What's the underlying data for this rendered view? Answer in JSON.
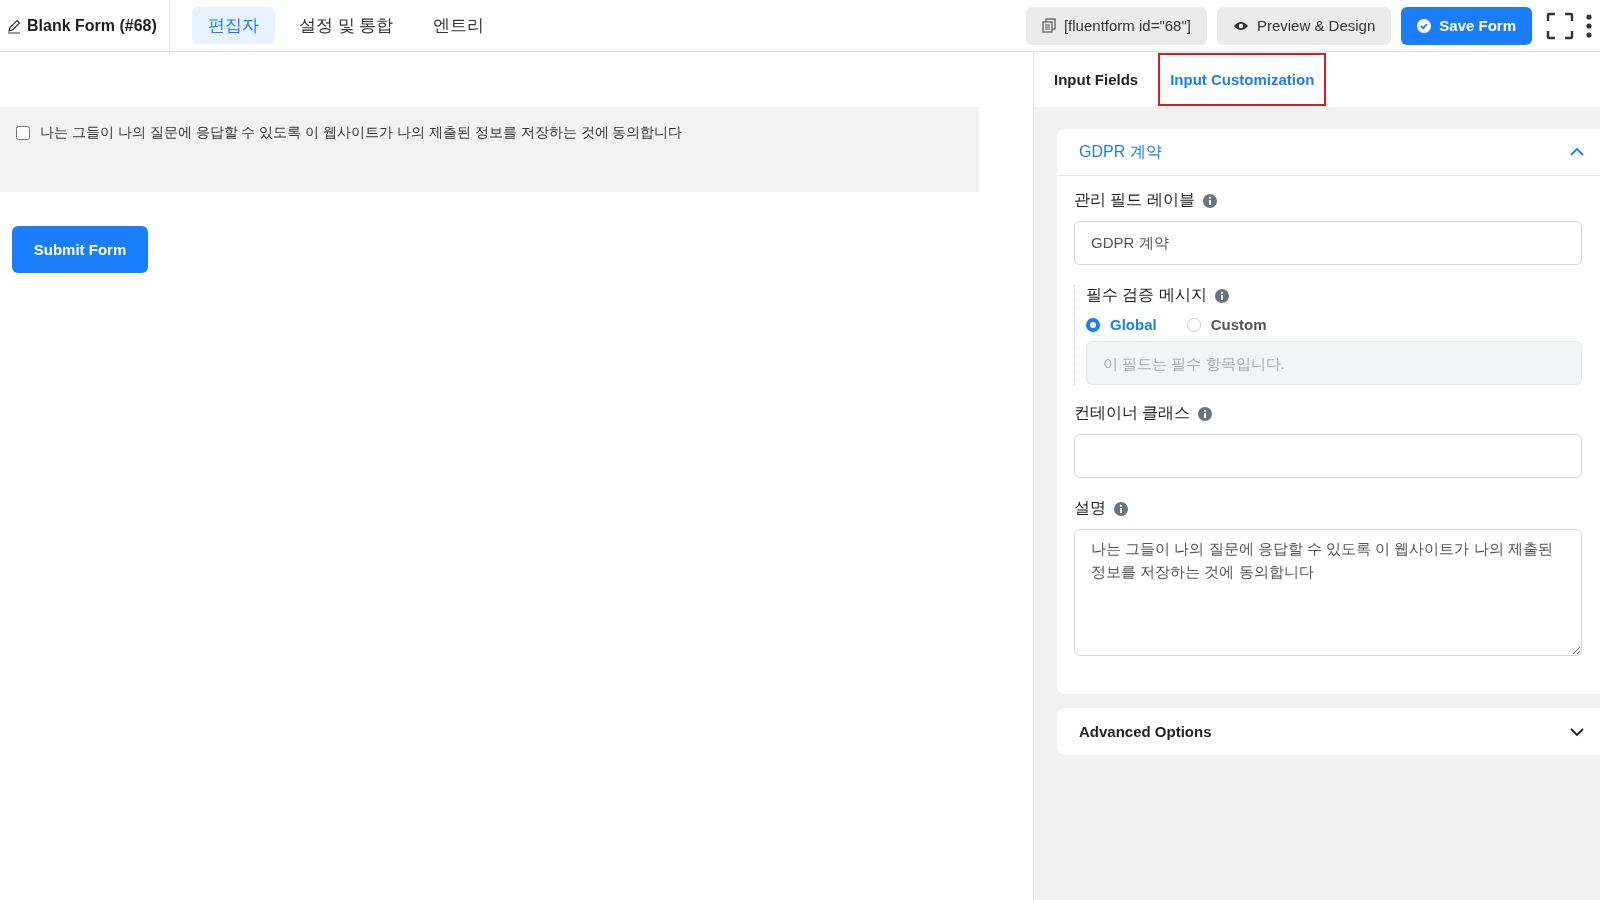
{
  "header": {
    "title": "Blank Form (#68)",
    "tabs": [
      {
        "label": "편집자",
        "selected": true
      },
      {
        "label": "설정 및 통합",
        "selected": false
      },
      {
        "label": "엔트리",
        "selected": false
      }
    ],
    "shortcode": "[fluentform id=\"68\"]",
    "preview_button": "Preview & Design",
    "save_button": "Save Form"
  },
  "form": {
    "checkbox": {
      "label": "나는 그들이 나의 질문에 응답할 수 있도록 이 웹사이트가 나의 제출된 정보를 저장하는 것에 동의합니다",
      "checked": false
    },
    "submit_button": "Submit Form"
  },
  "sidebar": {
    "tabs": [
      {
        "label": "Input Fields",
        "selected": false,
        "highlighted": false
      },
      {
        "label": "Input Customization",
        "selected": true,
        "highlighted": true
      }
    ],
    "section": {
      "title": "GDPR 계약",
      "expanded": true,
      "admin_label": {
        "label": "관리 필드 레이블",
        "value": "GDPR 계약"
      },
      "validation": {
        "label": "필수 검증 메시지",
        "options": [
          {
            "label": "Global",
            "selected": true
          },
          {
            "label": "Custom",
            "selected": false
          }
        ],
        "placeholder": "이 필드는 필수 항목입니다.",
        "disabled": true
      },
      "container_class": {
        "label": "컨테이너 클래스"
      },
      "description": {
        "label": "설명",
        "value": "나는 그들이 나의 질문에 응답할 수 있도록 이 웹사이트가 나의 제출된 정보를 저장하는 것에 동의합니다"
      }
    },
    "advanced": {
      "title": "Advanced Options",
      "expanded": false
    }
  }
}
